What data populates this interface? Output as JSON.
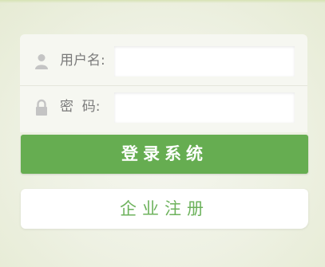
{
  "login": {
    "username_label": "用户名:",
    "username_value": "",
    "password_label": "密  码:",
    "password_value": "",
    "submit_label": "登录系统"
  },
  "register": {
    "label": "企业注册"
  },
  "icons": {
    "username": "user-icon",
    "password": "lock-icon"
  },
  "colors": {
    "primary": "#66ad51",
    "register_text": "#6db25c",
    "icon": "#c4c4c4"
  }
}
